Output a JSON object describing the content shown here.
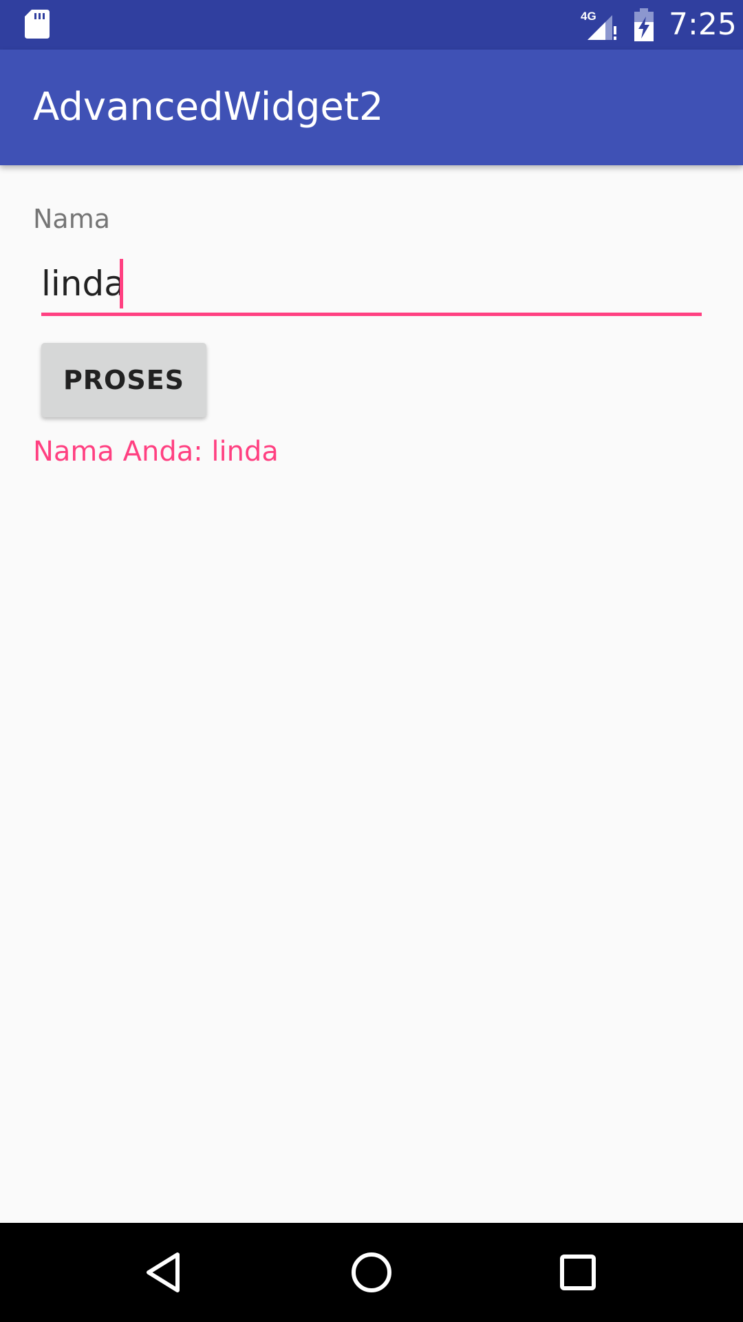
{
  "status_bar": {
    "time": "7:25",
    "network_label": "4G",
    "icons": [
      "sd-card-icon",
      "signal-icon",
      "battery-charging-icon"
    ]
  },
  "app_bar": {
    "title": "AdvancedWidget2"
  },
  "form": {
    "name_label": "Nama",
    "name_value": "linda",
    "process_button": "PROSES",
    "result_text": "Nama Anda: linda"
  },
  "nav_bar": {
    "icons": [
      "back-icon",
      "home-icon",
      "recents-icon"
    ]
  },
  "colors": {
    "status_bar": "#303F9F",
    "app_bar": "#3F51B5",
    "accent": "#FF4081",
    "background": "#FAFAFA",
    "button": "#D6D7D7"
  }
}
